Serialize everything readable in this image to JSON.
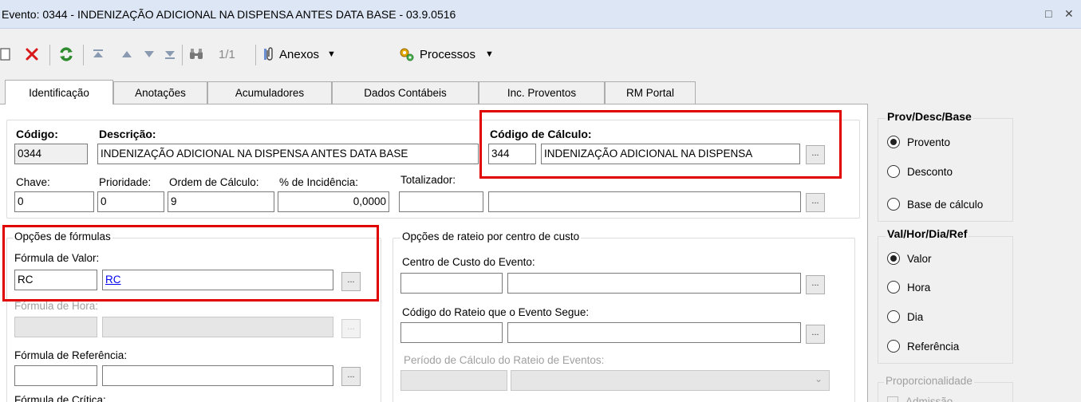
{
  "window": {
    "title": "Evento: 0344 - INDENIZAÇÃO ADICIONAL NA DISPENSA ANTES DATA BASE - 03.9.0516",
    "restore_glyph": "□",
    "close_glyph": "✕"
  },
  "toolbar": {
    "record_counter": "1/1",
    "anexos_label": "Anexos",
    "processos_label": "Processos"
  },
  "tabs": [
    {
      "label": "Identificação",
      "active": true
    },
    {
      "label": "Anotações"
    },
    {
      "label": "Acumuladores"
    },
    {
      "label": "Dados Contábeis"
    },
    {
      "label": "Inc. Proventos"
    },
    {
      "label": "RM Portal"
    }
  ],
  "form": {
    "codigo": {
      "label": "Código:",
      "value": "0344"
    },
    "descricao": {
      "label": "Descrição:",
      "value": "INDENIZAÇÃO ADICIONAL NA DISPENSA ANTES DATA BASE"
    },
    "codigo_calculo": {
      "label": "Código de Cálculo:",
      "code": "344",
      "description": "INDENIZAÇÃO ADICIONAL NA DISPENSA"
    },
    "chave": {
      "label": "Chave:",
      "value": "0"
    },
    "prioridade": {
      "label": "Prioridade:",
      "value": "0"
    },
    "ordem_calculo": {
      "label": "Ordem de Cálculo:",
      "value": "9"
    },
    "incidencia": {
      "label": "% de Incidência:",
      "value": "0,0000"
    },
    "totalizador": {
      "label": "Totalizador:",
      "code": "",
      "description": ""
    }
  },
  "formulas": {
    "group_title": "Opções de fórmulas",
    "valor": {
      "label": "Fórmula de Valor:",
      "code": "RC",
      "link": "RC"
    },
    "hora": {
      "label": "Fórmula de Hora:",
      "code": "",
      "description": ""
    },
    "referencia": {
      "label": "Fórmula de Referência:",
      "code": "",
      "description": ""
    },
    "critica": {
      "label": "Fórmula de Crítica:"
    }
  },
  "rateio": {
    "group_title": "Opções de rateio por centro de custo",
    "centro_custo": {
      "label": "Centro de Custo do Evento:",
      "code": "",
      "description": ""
    },
    "codigo_rateio": {
      "label": "Código do Rateio que o Evento Segue:",
      "code": "",
      "description": ""
    },
    "periodo": {
      "label": "Período de Cálculo do Rateio de Eventos:",
      "value": ""
    }
  },
  "prov_desc_base": {
    "title": "Prov/Desc/Base",
    "options": [
      "Provento",
      "Desconto",
      "Base de cálculo"
    ],
    "selected": "Provento"
  },
  "val_hor_dia_ref": {
    "title": "Val/Hor/Dia/Ref",
    "options": [
      "Valor",
      "Hora",
      "Dia",
      "Referência"
    ],
    "selected": "Valor"
  },
  "proporcionalidade": {
    "title": "Proporcionalidade",
    "first_option": "Admissão"
  },
  "colors": {
    "titlebar_bg": "#dce6f4",
    "highlight_border": "#e10000",
    "link": "#0000ee"
  }
}
